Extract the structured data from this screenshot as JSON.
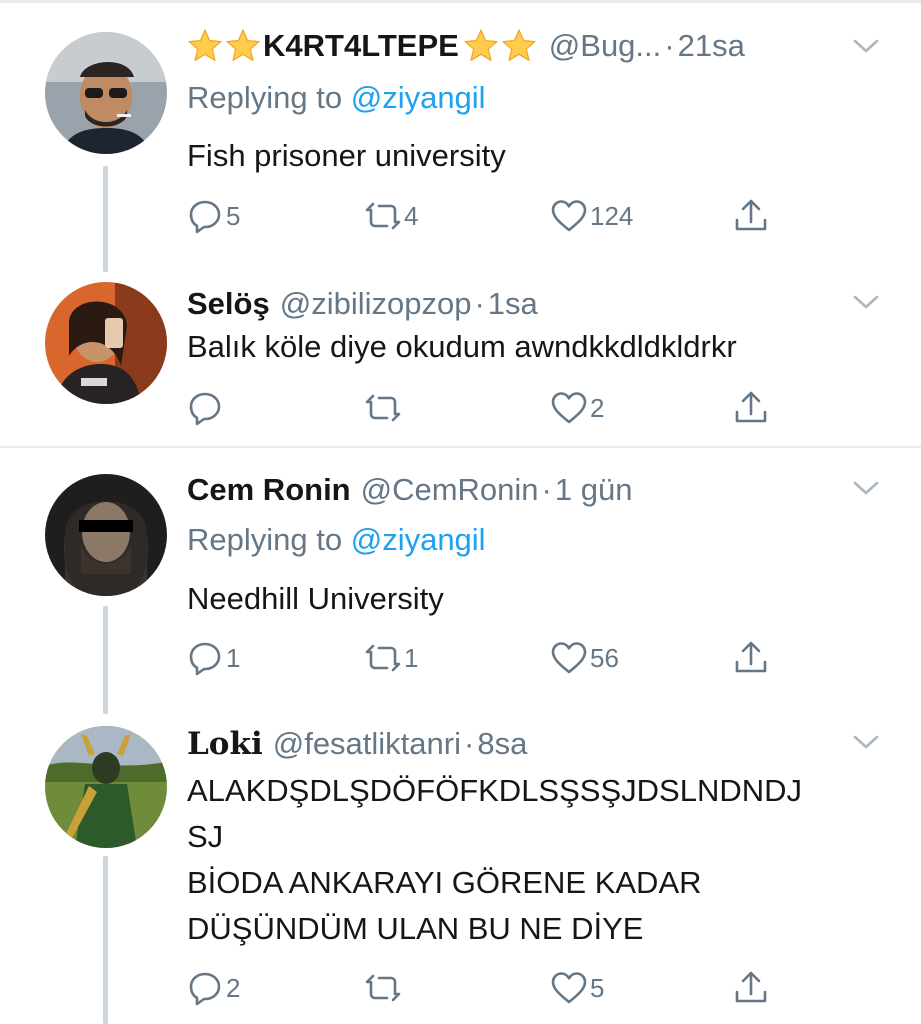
{
  "tweets": [
    {
      "name_prefix_stars": 2,
      "name": "K4RT4LTEPE",
      "name_suffix_stars": 2,
      "handle": "@Bug...",
      "time": "21sa",
      "replying_label": "Replying to",
      "replying_to": "@ziyangil",
      "text": "Fish prisoner university",
      "replies": "5",
      "retweets": "4",
      "likes": "124"
    },
    {
      "name": "Selöş",
      "handle": "@zibilizopzop",
      "time": "1sa",
      "text": "Balık köle diye okudum awndkkdldkldrkr",
      "replies": "",
      "retweets": "",
      "likes": "2"
    },
    {
      "name": "Cem Ronin",
      "handle": "@CemRonin",
      "time": "1 gün",
      "replying_label": "Replying to",
      "replying_to": "@ziyangil",
      "text": "Needhill University",
      "replies": "1",
      "retweets": "1",
      "likes": "56"
    },
    {
      "name": "𝐋𝐨𝐤𝐢",
      "handle": "@fesatliktanri",
      "time": "8sa",
      "text_lines": [
        "ALAKDŞDLŞDÖFÖFKDLSŞSŞJDSLNDNDJ",
        "SJ",
        "BİODA ANKARAYI GÖRENE KADAR",
        "DÜŞÜNDÜM ULAN BU NE DİYE"
      ],
      "replies": "2",
      "retweets": "",
      "likes": "5"
    }
  ],
  "separator": "·",
  "colors": {
    "link": "#1da1f2",
    "muted": "#657786",
    "line": "#ccd6dd",
    "divider": "#e6ecf0"
  },
  "icons": [
    "reply-icon",
    "retweet-icon",
    "like-icon",
    "share-icon",
    "caret-down-icon",
    "star-emoji-icon"
  ]
}
